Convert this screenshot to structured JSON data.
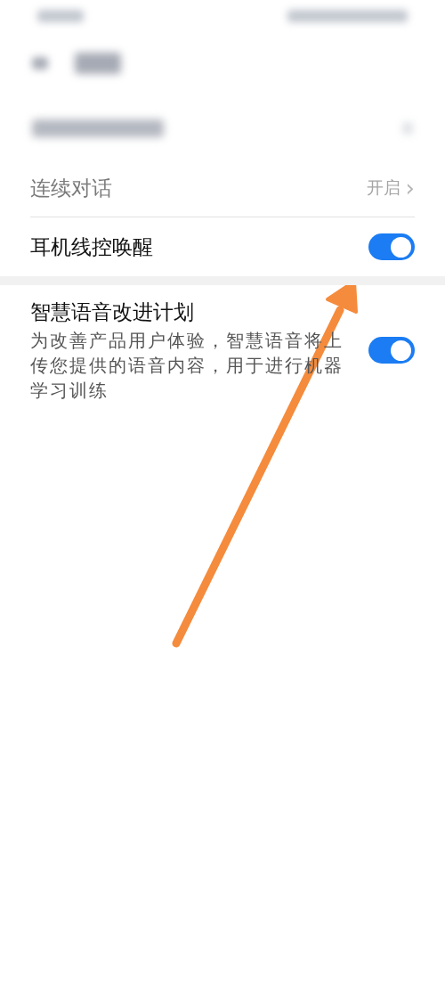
{
  "sections": [
    {
      "rows": [
        {
          "kind": "link",
          "label": "连续对话",
          "value": "开启",
          "chevron": "›"
        },
        {
          "kind": "toggle",
          "label": "耳机线控唤醒",
          "on": true
        }
      ]
    },
    {
      "rows": [
        {
          "kind": "toggle",
          "label": "智慧语音改进计划",
          "description": "为改善产品用户体验，智慧语音将上传您提供的语音内容，用于进行机器学习训练",
          "on": true
        }
      ]
    }
  ]
}
